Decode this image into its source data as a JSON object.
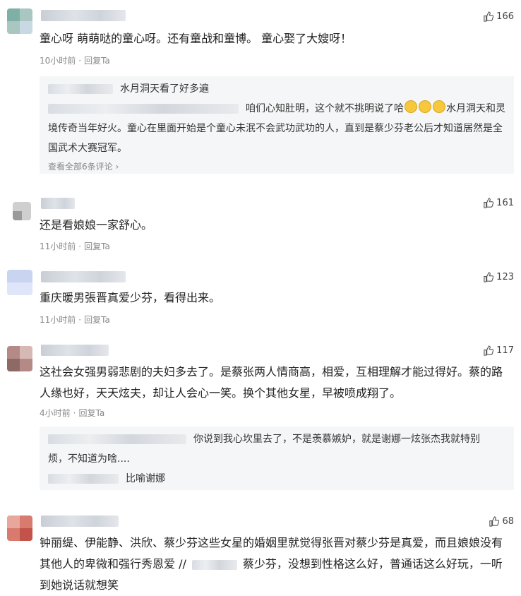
{
  "comments": [
    {
      "likes": "166",
      "text": "童心呀 萌萌哒的童心呀。还有童战和童博。 童心娶了大嫂呀！",
      "time": "10小时前",
      "reply_label": "回复Ta",
      "replies": [
        {
          "text": "水月洞天看了好多遍"
        },
        {
          "text_a": "咱们心知肚明，这个就不挑明说了哈",
          "text_b": "水月洞天和灵境传奇当年好火。童心在里面开始是个童心未泯不会武功武功的人，直到是蔡少芬老公后才知道居然是全国武术大赛冠军。"
        }
      ],
      "view_all": "查看全部6条评论"
    },
    {
      "likes": "161",
      "text": "还是看娘娘一家舒心。",
      "time": "11小时前",
      "reply_label": "回复Ta"
    },
    {
      "likes": "123",
      "text": "重庆暖男張晋真爱少芬，看得出来。",
      "time": "11小时前",
      "reply_label": "回复Ta"
    },
    {
      "likes": "117",
      "text": "这社会女强男弱悲剧的夫妇多去了。是蔡张两人情商高，相爱，互相理解才能过得好。蔡的路人缘也好，天天炫夫，却让人会心一笑。换个其他女星，早被喷成翔了。",
      "time": "4小时前",
      "reply_label": "回复Ta",
      "replies": [
        {
          "text": "你说到我心坎里去了，不是羡慕嫉妒，就是谢娜一炫张杰我就特别烦，不知道为啥...."
        },
        {
          "text": "比喻谢娜"
        }
      ]
    },
    {
      "likes": "68",
      "text_a": "钟丽缇、伊能静、洪欣、蔡少芬这些女星的婚姻里就觉得张晋对蔡少芬是真爱，而且娘娘没有其他人的卑微和强行秀恩爱 //",
      "text_b": "蔡少芬，没想到性格这么好，普通话这么好玩，一听到她说话就想笑"
    }
  ],
  "colors": {
    "meta": "#888888",
    "reply_bg": "#f5f6f7",
    "text": "#222222"
  },
  "icons": {
    "like": "thumbs-up-icon"
  }
}
